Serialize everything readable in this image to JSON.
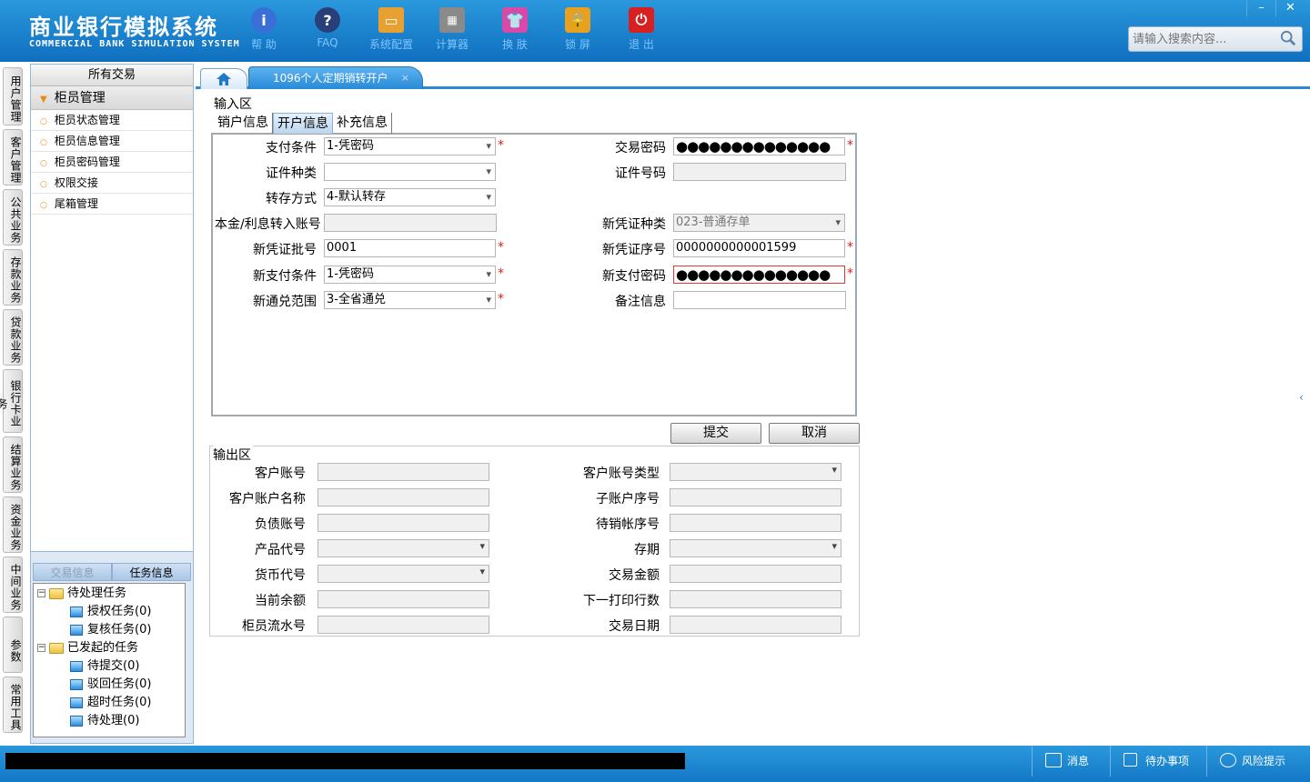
{
  "app": {
    "title_cn": "商业银行模拟系统",
    "title_en": "COMMERCIAL BANK SIMULATION SYSTEM"
  },
  "toolbar": [
    {
      "label": "帮 助",
      "icon": "info-icon",
      "color": "#3a6fd8"
    },
    {
      "label": "FAQ",
      "icon": "question-icon",
      "color": "#2a3f7a"
    },
    {
      "label": "系统配置",
      "icon": "toolbox-icon",
      "color": "#e8a030"
    },
    {
      "label": "计算器",
      "icon": "calculator-icon",
      "color": "#8a8a8a"
    },
    {
      "label": "换 肤",
      "icon": "shirt-icon",
      "color": "#d84aa8"
    },
    {
      "label": "锁 屏",
      "icon": "lock-icon",
      "color": "#e8a020"
    },
    {
      "label": "退 出",
      "icon": "power-icon",
      "color": "#d82020"
    }
  ],
  "window": {
    "minimize": "–",
    "close": "✕"
  },
  "search": {
    "placeholder": "请输入搜索内容..."
  },
  "vtabs": [
    "用户管理",
    "客户管理",
    "公共业务",
    "存款业务",
    "贷款业务",
    "银行卡业务",
    "结算业务",
    "资金业务",
    "中间业务",
    "参数",
    "常用工具"
  ],
  "sidebar": {
    "title": "所有交易",
    "group": "柜员管理",
    "items": [
      "柜员状态管理",
      "柜员信息管理",
      "柜员密码管理",
      "权限交接",
      "尾箱管理"
    ]
  },
  "task_panel": {
    "tabs": [
      "交易信息",
      "任务信息"
    ],
    "tree": [
      {
        "label": "待处理任务",
        "children": [
          "授权任务(0)",
          "复核任务(0)"
        ]
      },
      {
        "label": "已发起的任务",
        "children": [
          "待提交(0)",
          "驳回任务(0)",
          "超时任务(0)",
          "待处理(0)"
        ]
      }
    ]
  },
  "content_tab": {
    "label": "1096个人定期销转开户",
    "close": "×"
  },
  "input_area": {
    "label": "输入区",
    "subtabs": [
      "销户信息",
      "开户信息",
      "补充信息"
    ],
    "left_fields": [
      {
        "label": "支付条件",
        "value": "1-凭密码",
        "select": true,
        "required": true
      },
      {
        "label": "证件种类",
        "value": "",
        "select": true,
        "required": false
      },
      {
        "label": "转存方式",
        "value": "4-默认转存",
        "select": true,
        "required": false
      },
      {
        "label": "本金/利息转入账号",
        "value": "",
        "disabled": true
      },
      {
        "label": "新凭证批号",
        "value": "0001",
        "required": true
      },
      {
        "label": "新支付条件",
        "value": "1-凭密码",
        "select": true,
        "required": true
      },
      {
        "label": "新通兑范围",
        "value": "3-全省通兑",
        "select": true,
        "required": true
      }
    ],
    "right_fields": [
      {
        "label": "交易密码",
        "value": "●●●●●●●●●●●●●●",
        "password": true,
        "required": true
      },
      {
        "label": "证件号码",
        "value": "",
        "disabled": true
      },
      {
        "label": "新凭证种类",
        "value": "023-普通存单",
        "select": true,
        "disabled": true
      },
      {
        "label": "新凭证序号",
        "value": "0000000000001599",
        "required": true
      },
      {
        "label": "新支付密码",
        "value": "●●●●●●●●●●●●●●",
        "password": true,
        "required": true,
        "error": true
      },
      {
        "label": "备注信息",
        "value": ""
      }
    ],
    "submit_label": "提交",
    "cancel_label": "取消"
  },
  "output_area": {
    "label": "输出区",
    "left_fields": [
      {
        "label": "客户账号",
        "select": false
      },
      {
        "label": "客户账户名称",
        "select": false
      },
      {
        "label": "负债账号",
        "select": false
      },
      {
        "label": "产品代号",
        "select": true
      },
      {
        "label": "货币代号",
        "select": true
      },
      {
        "label": "当前余额",
        "select": false
      },
      {
        "label": "柜员流水号",
        "select": false
      }
    ],
    "right_fields": [
      {
        "label": "客户账号类型",
        "select": true
      },
      {
        "label": "子账户序号",
        "select": false
      },
      {
        "label": "待销帐序号",
        "select": false
      },
      {
        "label": "存期",
        "select": true
      },
      {
        "label": "交易金额",
        "select": false
      },
      {
        "label": "下一打印行数",
        "select": false
      },
      {
        "label": "交易日期",
        "select": false
      }
    ]
  },
  "statusbar": [
    {
      "label": "消息",
      "icon": "mail-icon"
    },
    {
      "label": "待办事项",
      "icon": "checkbox-icon"
    },
    {
      "label": "风险提示",
      "icon": "chat-icon"
    }
  ]
}
